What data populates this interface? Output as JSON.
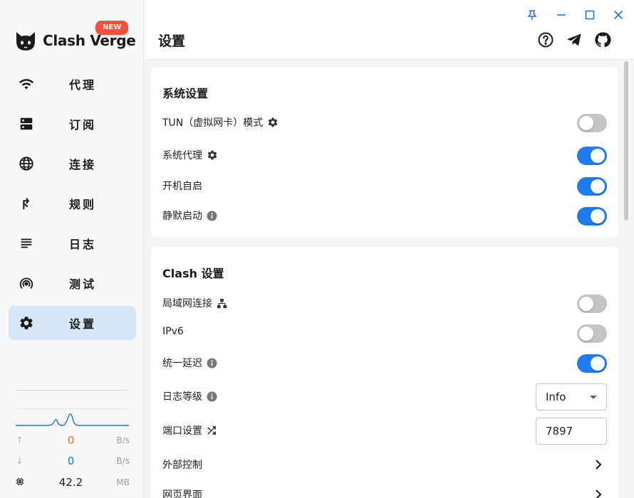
{
  "app": {
    "name": "Clash Verge",
    "badge": "NEW"
  },
  "sidebar": {
    "items": [
      {
        "label": "代理",
        "icon": "wifi-icon"
      },
      {
        "label": "订阅",
        "icon": "dns-icon"
      },
      {
        "label": "连接",
        "icon": "globe-icon"
      },
      {
        "label": "规则",
        "icon": "fork-icon"
      },
      {
        "label": "日志",
        "icon": "lines-icon"
      },
      {
        "label": "测试",
        "icon": "broadcast-icon"
      },
      {
        "label": "设置",
        "icon": "gear-icon",
        "active": true
      }
    ]
  },
  "traffic": {
    "upload": {
      "value": "0",
      "unit": "B/s",
      "color": "#f26b3a"
    },
    "download": {
      "value": "0",
      "unit": "B/s",
      "color": "#1e74e8"
    },
    "memory": {
      "value": "42.2",
      "unit": "MB"
    }
  },
  "header": {
    "title": "设置"
  },
  "system_settings": {
    "title": "系统设置",
    "rows": [
      {
        "label": "TUN（虚拟网卡）模式",
        "icon": "gear-icon",
        "toggle": false
      },
      {
        "label": "系统代理",
        "icon": "gear-icon",
        "toggle": true
      },
      {
        "label": "开机自启",
        "toggle": true
      },
      {
        "label": "静默启动",
        "icon": "info-icon",
        "toggle": true
      }
    ]
  },
  "clash_settings": {
    "title": "Clash 设置",
    "rows": [
      {
        "label": "局域网连接",
        "icon": "network-icon",
        "toggle": false
      },
      {
        "label": "IPv6",
        "toggle": false
      },
      {
        "label": "统一延迟",
        "icon": "info-icon",
        "toggle": true
      },
      {
        "label": "日志等级",
        "icon": "info-icon",
        "select_value": "Info"
      },
      {
        "label": "端口设置",
        "icon": "shuffle-icon",
        "input_value": "7897"
      },
      {
        "label": "外部控制"
      },
      {
        "label": "网页界面"
      }
    ]
  },
  "colors": {
    "accent": "#1e7cf0",
    "active_nav_bg": "#d5e6f8",
    "toggle_off": "#c4c4c4"
  }
}
